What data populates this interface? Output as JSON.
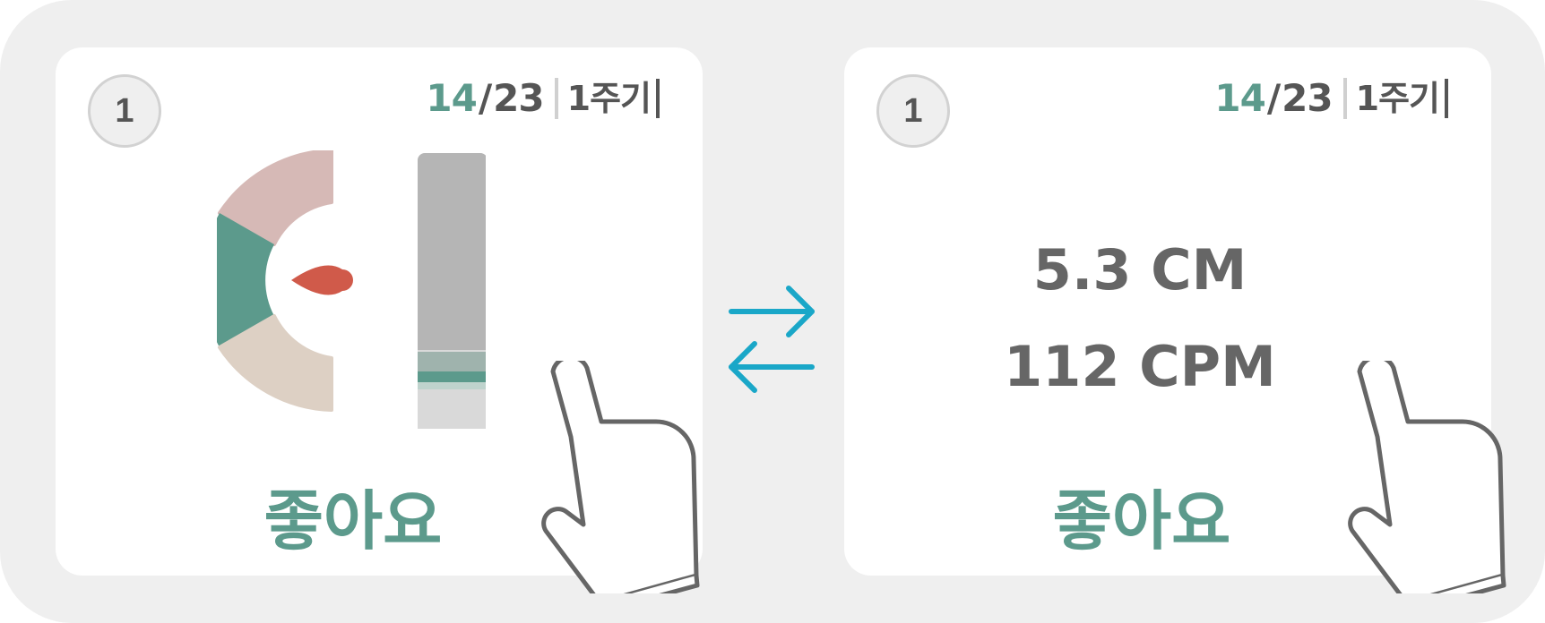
{
  "left_card": {
    "step_number": "1",
    "progress_done": "14",
    "progress_separator": "/",
    "progress_total": "23",
    "cycle_label": "1주기",
    "result_label": "좋아요"
  },
  "right_card": {
    "step_number": "1",
    "progress_done": "14",
    "progress_separator": "/",
    "progress_total": "23",
    "cycle_label": "1주기",
    "depth_value": "5.3 CM",
    "rate_value": "112 CPM",
    "result_label": "좋아요"
  },
  "colors": {
    "accent_green": "#5c9a8c",
    "gauge_top_pink": "#d6b9b6",
    "gauge_bottom_beige": "#ddd0c4",
    "needle_red": "#d05a4a",
    "swap_arrow_blue": "#1aa7c8",
    "text_gray": "#666666"
  },
  "icons": {
    "hand": "tap-hand-icon",
    "swap": "swap-arrows-icon"
  }
}
